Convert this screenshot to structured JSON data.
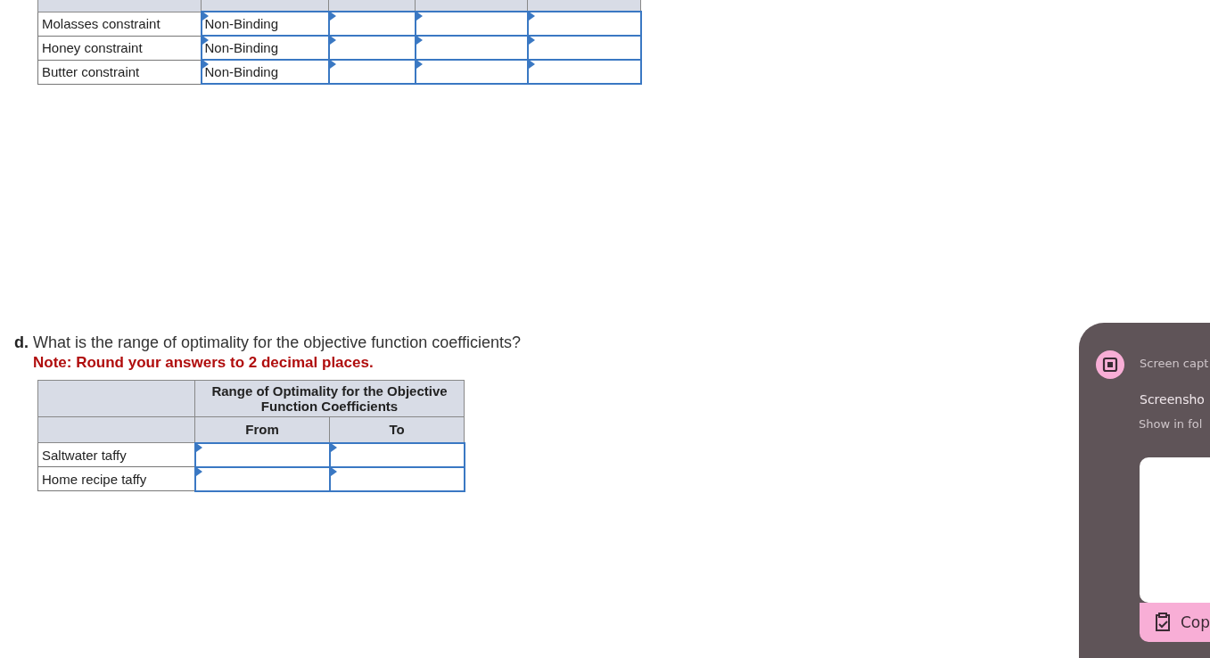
{
  "shadow_table": {
    "rows": [
      {
        "label": "Molasses constraint",
        "status": "Non-Binding"
      },
      {
        "label": "Honey constraint",
        "status": "Non-Binding"
      },
      {
        "label": "Butter constraint",
        "status": "Non-Binding"
      }
    ]
  },
  "question_d": {
    "letter": "d.",
    "text": "What is the range of optimality for the objective function coefficients?",
    "note": "Note: Round your answers to 2 decimal places.",
    "table": {
      "group_header": "Range of Optimality for the Objective Function Coefficients",
      "columns": [
        "From",
        "To"
      ],
      "rows": [
        "Saltwater taffy",
        "Home recipe taffy"
      ]
    }
  },
  "notification": {
    "source": "Screen capt",
    "title": "Screensho",
    "subtitle": "Show in fol",
    "action": "Cop"
  }
}
